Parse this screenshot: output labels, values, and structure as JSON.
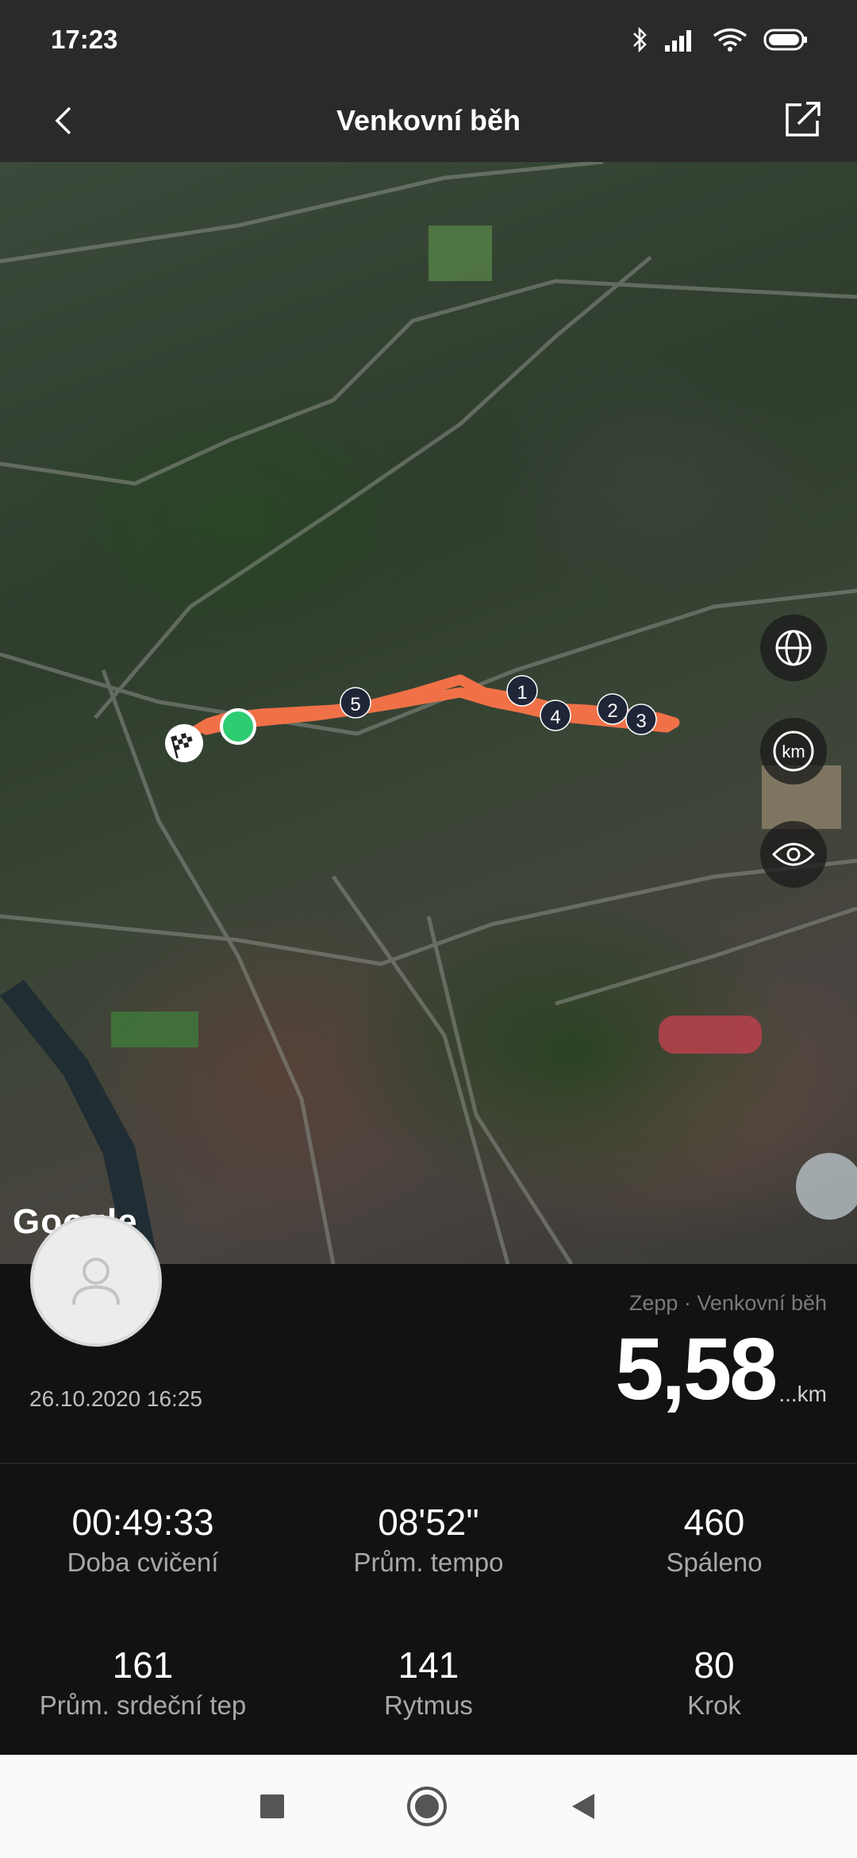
{
  "status_bar": {
    "time": "17:23"
  },
  "header": {
    "title": "Venkovní běh"
  },
  "map": {
    "attribution": "Google",
    "route_color": "#f07147",
    "start_marker_color": "#2ecc71",
    "km_markers": [
      "1",
      "2",
      "3",
      "4",
      "5"
    ],
    "buttons": [
      "globe-icon",
      "km-icon",
      "eye-icon"
    ]
  },
  "summary": {
    "source": "Zepp · Venkovní běh",
    "distance": "5,58",
    "distance_unit": "...km",
    "datetime": "26.10.2020 16:25"
  },
  "stats": [
    {
      "value": "00:49:33",
      "label": "Doba cvičení"
    },
    {
      "value": "08'52\"",
      "label": "Prům. tempo"
    },
    {
      "value": "460",
      "label": "Spáleno"
    },
    {
      "value": "161",
      "label": "Prům. srdeční tep"
    },
    {
      "value": "141",
      "label": "Rytmus"
    },
    {
      "value": "80",
      "label": "Krok"
    }
  ]
}
